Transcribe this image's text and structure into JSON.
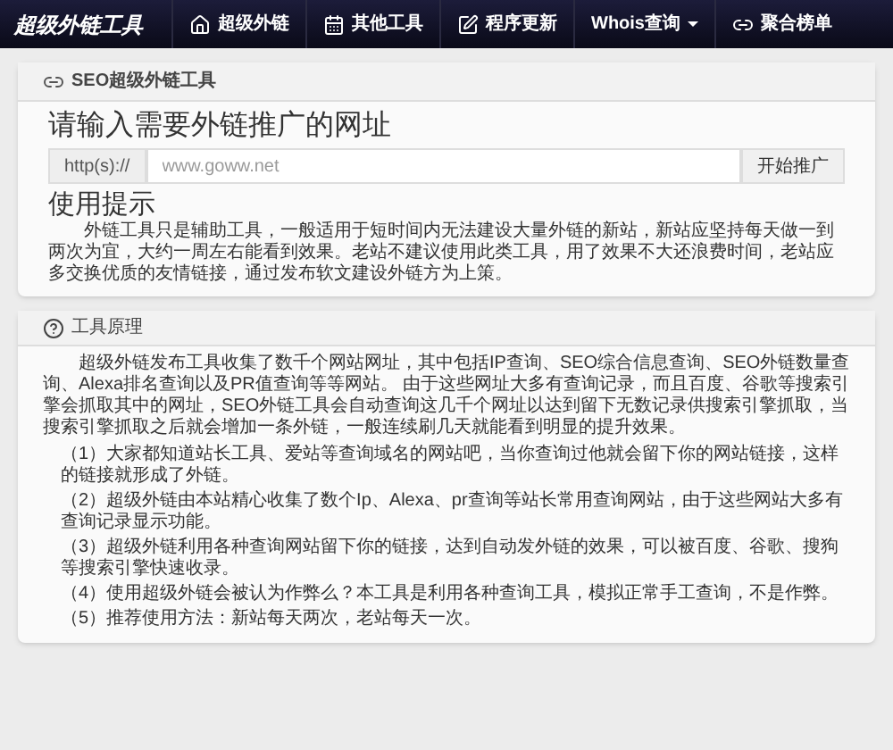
{
  "navbar": {
    "logo": "超级外链工具",
    "items": [
      {
        "label": "超级外链",
        "dropdown": false
      },
      {
        "label": "其他工具",
        "dropdown": false
      },
      {
        "label": "程序更新",
        "dropdown": false
      },
      {
        "label": "Whois查询",
        "dropdown": true
      },
      {
        "label": "聚合榜单",
        "dropdown": false
      }
    ]
  },
  "tool_panel": {
    "title": "SEO超级外链工具",
    "heading": "请输入需要外链推广的网址",
    "url_prefix": "http(s)://",
    "url_field": {
      "placeholder": "www.goww.net"
    },
    "submit": "开始推广",
    "tips_heading": "使用提示",
    "tips": "外链工具只是辅助工具，一般适用于短时间内无法建设大量外链的新站，新站应坚持每天做一到两次为宜，大约一周左右能看到效果。老站不建议使用此类工具，用了效果不大还浪费时间，老站应多交换优质的友情链接，通过发布软文建设外链方为上策。"
  },
  "principle_panel": {
    "title": "工具原理",
    "intro": "超级外链发布工具收集了数千个网站网址，其中包括IP查询、SEO综合信息查询、SEO外链数量查询、Alexa排名查询以及PR值查询等等网站。 由于这些网址大多有查询记录，而且百度、谷歌等搜索引擎会抓取其中的网址，SEO外链工具会自动查询这几千个网址以达到留下无数记录供搜索引擎抓取，当搜索引擎抓取之后就会增加一条外链，一般连续刷几天就能看到明显的提升效果。",
    "points": [
      "（1）大家都知道站长工具、爱站等查询域名的网站吧，当你查询过他就会留下你的网站链接，这样的链接就形成了外链。",
      "（2）超级外链由本站精心收集了数个Ip、Alexa、pr查询等站长常用查询网站，由于这些网站大多有查询记录显示功能。",
      "（3）超级外链利用各种查询网站留下你的链接，达到自动发外链的效果，可以被百度、谷歌、搜狗等搜索引擎快速收录。",
      "（4）使用超级外链会被认为作弊么？本工具是利用各种查询工具，模拟正常手工查询，不是作弊。",
      "（5）推荐使用方法：新站每天两次，老站每天一次。"
    ]
  }
}
